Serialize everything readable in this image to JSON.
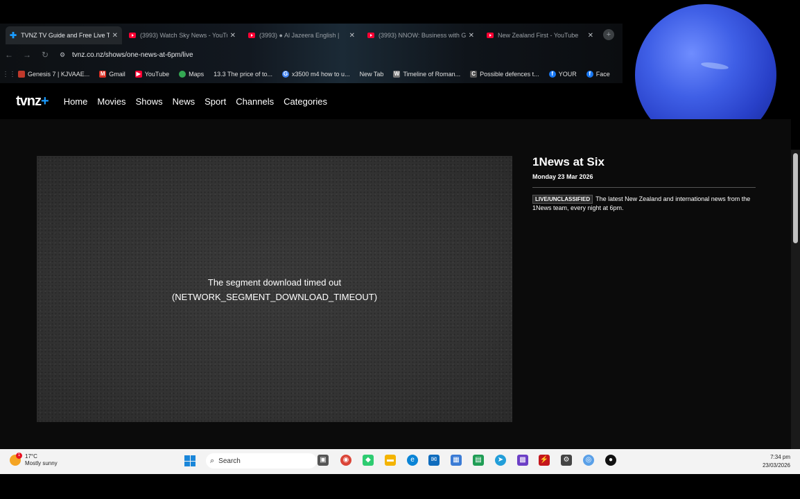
{
  "browser": {
    "tabs": [
      {
        "title": "TVNZ TV Guide and Free Live T",
        "active": true,
        "favicon": "tvnz-icon"
      },
      {
        "title": "(3993) Watch Sky News - YouTu",
        "active": false,
        "favicon": "youtube-icon"
      },
      {
        "title": "(3993) ● Al Jazeera English |",
        "active": false,
        "favicon": "youtube-icon"
      },
      {
        "title": "(3993) NNOW: Business with G",
        "active": false,
        "favicon": "youtube-icon"
      },
      {
        "title": "New Zealand First - YouTube",
        "active": false,
        "favicon": "youtube-icon"
      }
    ],
    "url": "tvnz.co.nz/shows/one-news-at-6pm/live",
    "bookmarks": [
      {
        "label": "Genesis 7 | KJVAAE...",
        "icon": "bible-icon",
        "color": "#c0392b"
      },
      {
        "label": "Gmail",
        "icon": "gmail-icon",
        "color": "#d93025"
      },
      {
        "label": "YouTube",
        "icon": "youtube-icon",
        "color": "#ff0033"
      },
      {
        "label": "Maps",
        "icon": "maps-icon",
        "color": "#34a853"
      },
      {
        "label": "13.3 The price of to...",
        "icon": "",
        "color": ""
      },
      {
        "label": "x3500 m4 how to u...",
        "icon": "google-icon",
        "color": "#4285f4"
      },
      {
        "label": "New Tab",
        "icon": "",
        "color": ""
      },
      {
        "label": "Timeline of Roman...",
        "icon": "wikipedia-icon",
        "color": "#777"
      },
      {
        "label": "Possible defences t...",
        "icon": "cl-icon",
        "color": "#555"
      },
      {
        "label": "YOUR",
        "icon": "facebook-icon",
        "color": "#1877f2"
      },
      {
        "label": "Face",
        "icon": "facebook-icon",
        "color": "#1877f2"
      }
    ]
  },
  "site": {
    "logo": "tvnz",
    "logo_plus": "+",
    "nav": [
      "Home",
      "Movies",
      "Shows",
      "News",
      "Sport",
      "Channels",
      "Categories"
    ]
  },
  "player": {
    "error_line1": "The segment download timed out",
    "error_line2": "(NETWORK_SEGMENT_DOWNLOAD_TIMEOUT)"
  },
  "show": {
    "title": "1News at Six",
    "date": "Monday 23 Mar 2026",
    "badge": "LIVE/UNCLASSIFIED",
    "description": "The latest New Zealand and international news from the 1News team, every night at 6pm."
  },
  "taskbar": {
    "weather_temp": "17°C",
    "weather_desc": "Mostly sunny",
    "weather_alert": "1",
    "search_placeholder": "Search",
    "time": "7:34 pm",
    "date": "23/03/2026"
  }
}
